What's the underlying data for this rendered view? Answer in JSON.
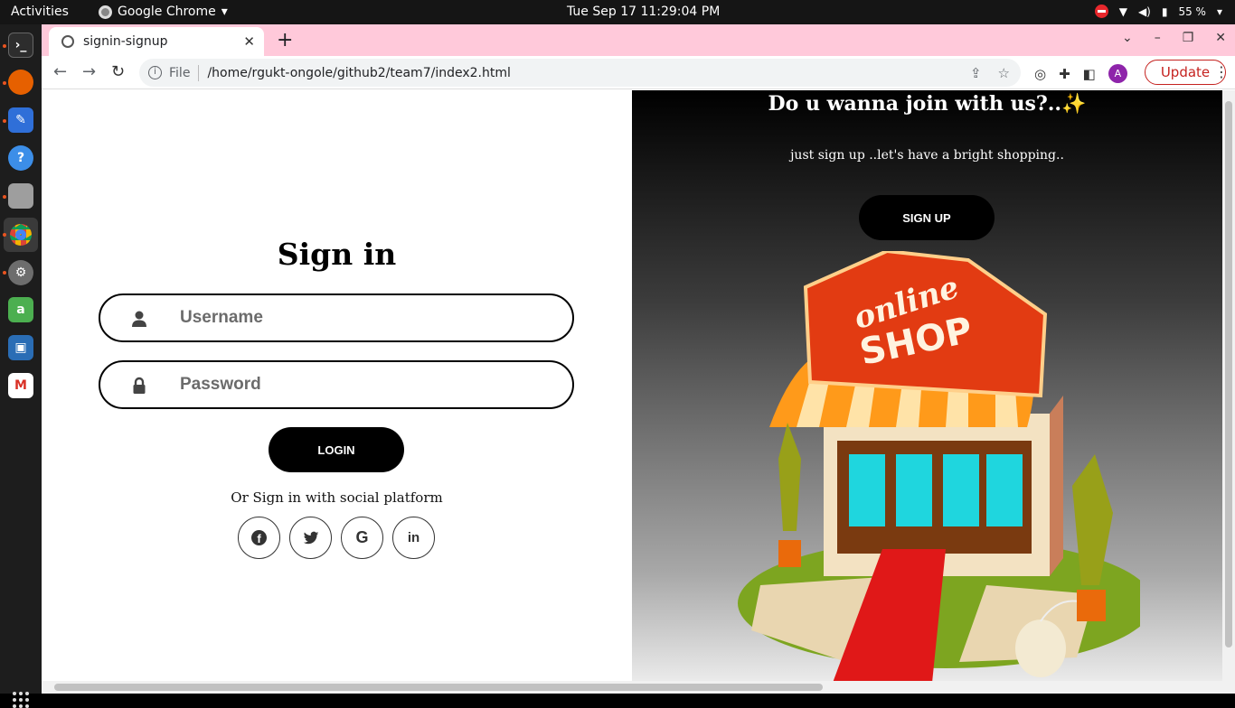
{
  "system_bar": {
    "activities": "Activities",
    "app_name": "Google Chrome",
    "clock": "Tue Sep 17  11:29:04 PM",
    "battery": "55 %"
  },
  "dock": {
    "items": [
      "terminal-icon",
      "firefox-icon",
      "text-editor-icon",
      "help-icon",
      "files-icon",
      "chrome-icon",
      "settings-icon",
      "software-icon",
      "virtualbox-icon",
      "gmail-icon"
    ]
  },
  "browser": {
    "tab_title": "signin-signup",
    "address_scheme": "File",
    "address_url": "/home/rgukt-ongole/github2/team7/index2.html",
    "profile_initial": "A",
    "update_label": "Update"
  },
  "signin": {
    "title": "Sign in",
    "username_placeholder": "Username",
    "password_placeholder": "Password",
    "login_label": "LOGIN",
    "social_text": "Or Sign in with social platform",
    "social": [
      {
        "name": "facebook-icon",
        "glyph": "f"
      },
      {
        "name": "twitter-icon",
        "glyph": "t"
      },
      {
        "name": "google-icon",
        "glyph": "G"
      },
      {
        "name": "linkedin-icon",
        "glyph": "in"
      }
    ]
  },
  "signup_panel": {
    "title": "Do u wanna join with us?..✨",
    "subtitle": "just sign up ..let's have a bright shopping..",
    "signup_label": "SIGN UP",
    "sign_line1": "online",
    "sign_line2": "SHOP"
  },
  "colors": {
    "tab_strip": "#ffc9da",
    "button_bg": "#000000",
    "update_red": "#c5221f",
    "profile_purple": "#8e24aa"
  }
}
